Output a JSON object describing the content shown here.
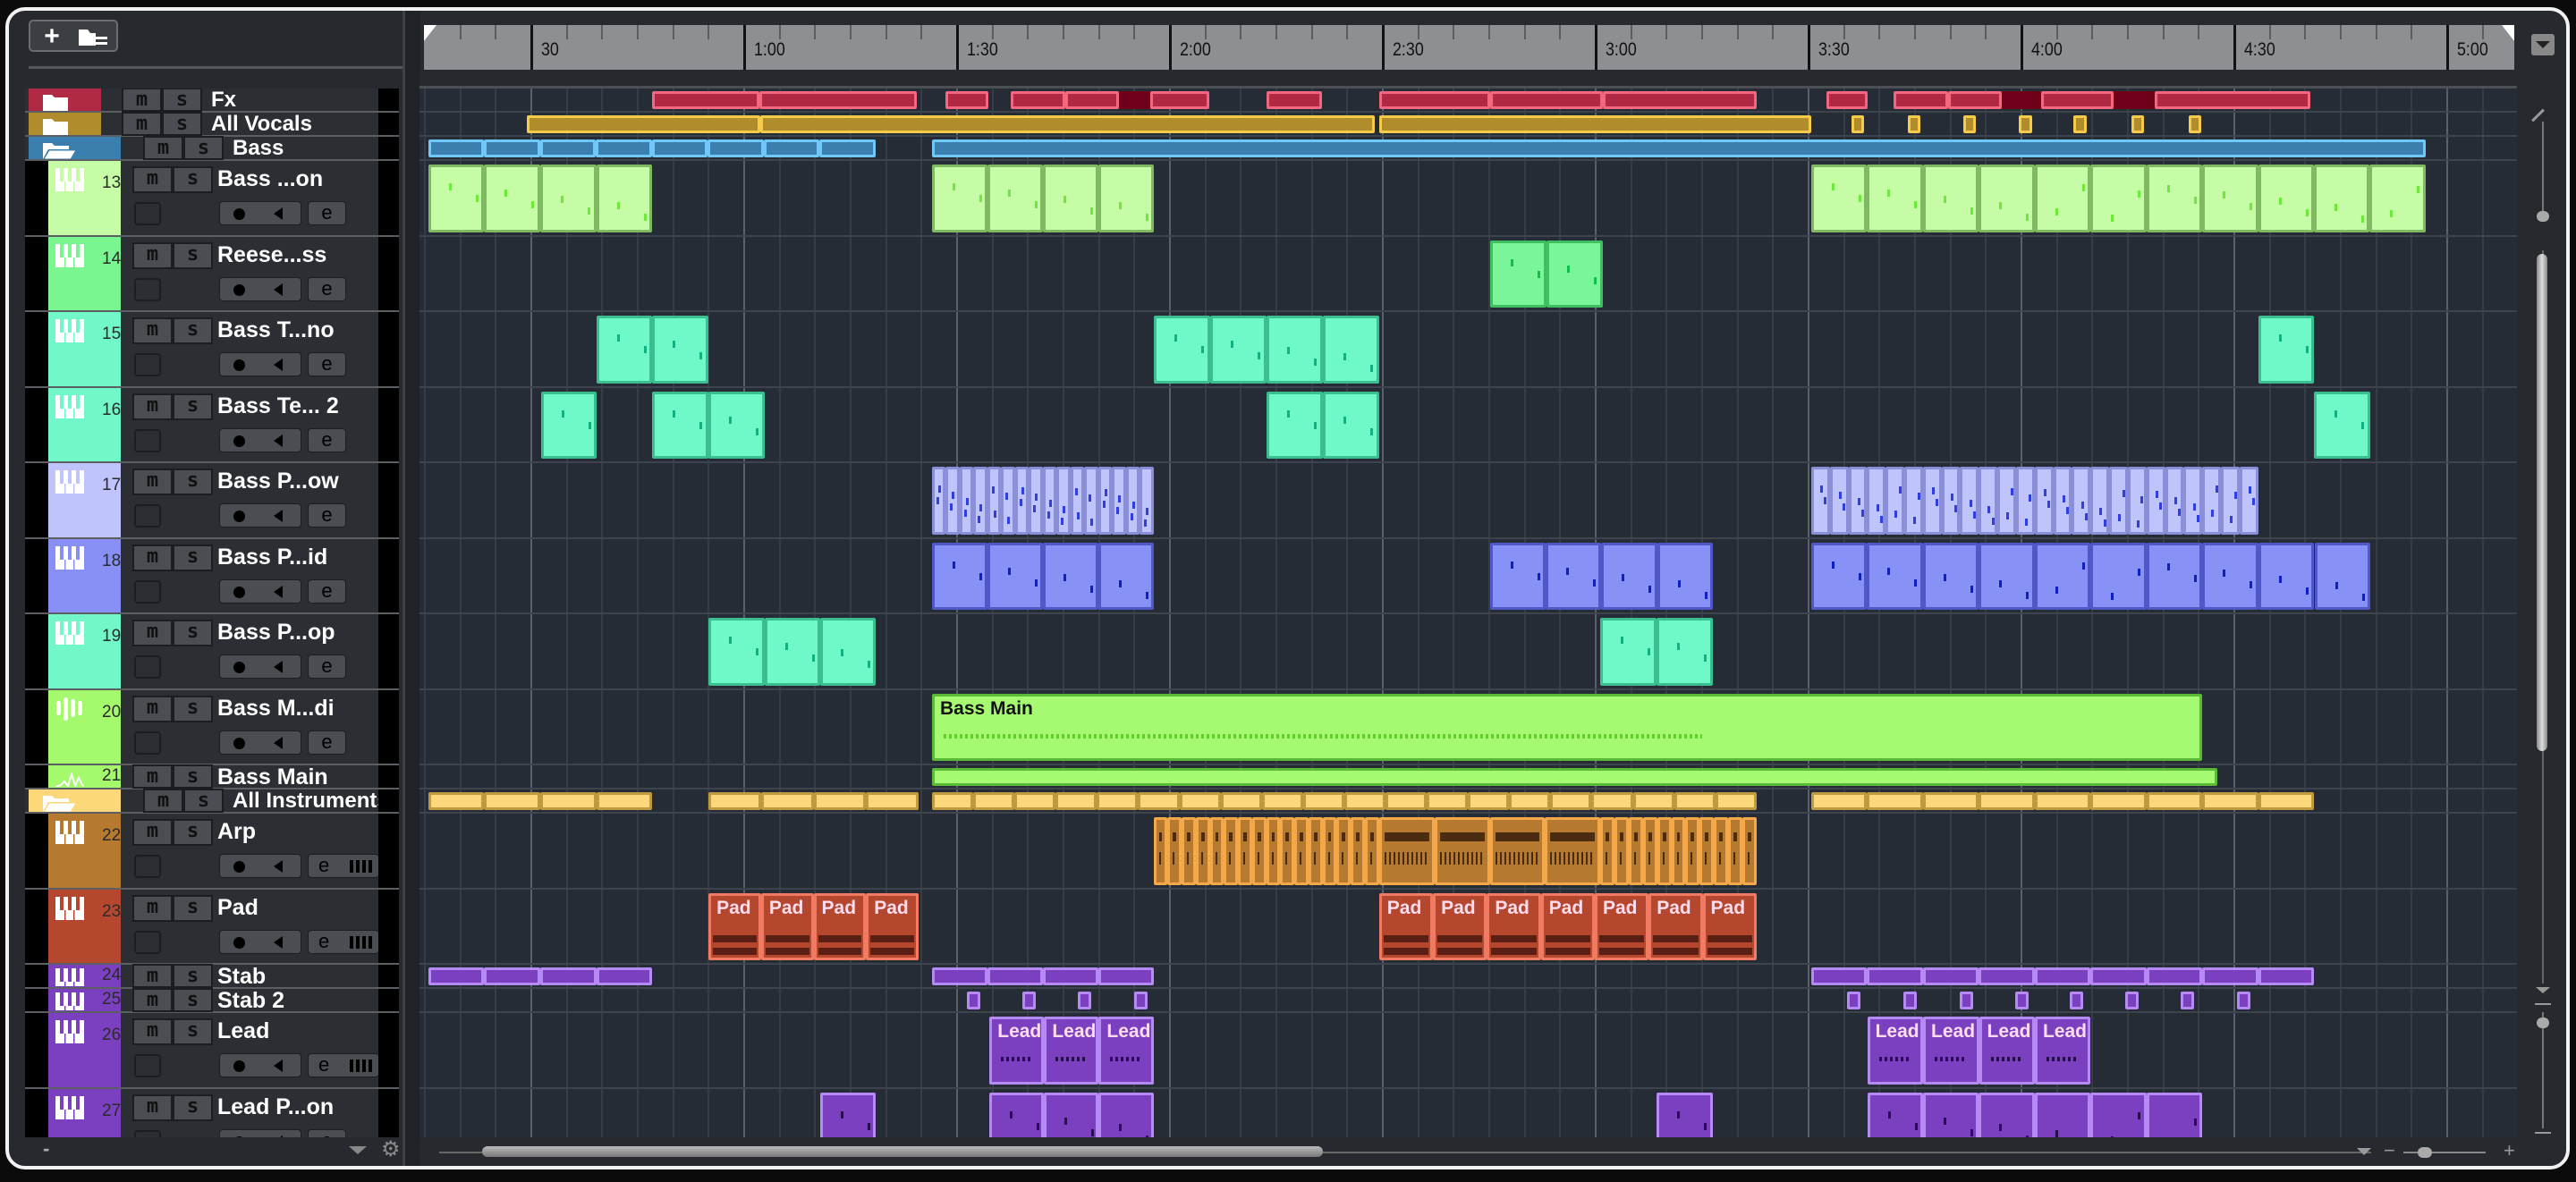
{
  "toolbar": {
    "add": "+",
    "add_icon": "plus-icon",
    "folder_icon": "track-folder-icon"
  },
  "bottom": {
    "minus": "-",
    "plus": "+",
    "zoom_minus": "−"
  },
  "ruler": {
    "range_sec": [
      15.5,
      309.6
    ],
    "labels": [
      {
        "t": 30,
        "text": "30"
      },
      {
        "t": 60,
        "text": "1:00"
      },
      {
        "t": 90,
        "text": "1:30"
      },
      {
        "t": 120,
        "text": "2:00"
      },
      {
        "t": 150,
        "text": "2:30"
      },
      {
        "t": 180,
        "text": "3:00"
      },
      {
        "t": 210,
        "text": "3:30"
      },
      {
        "t": 240,
        "text": "4:00"
      },
      {
        "t": 270,
        "text": "4:30"
      },
      {
        "t": 300,
        "text": "5:00"
      }
    ]
  },
  "track_controls": {
    "mute": "m",
    "solo": "s",
    "edit": "e"
  },
  "tracks": [
    {
      "kind": "folder",
      "name": "Fx",
      "color": "#b02a45",
      "open": false,
      "fill": "#b02a45",
      "border": "#f5677f",
      "clips": [
        {
          "s": 47.2,
          "e": 62.3,
          "n": 1
        },
        {
          "s": 62.3,
          "e": 84.5,
          "n": 1
        },
        {
          "s": 88.5,
          "e": 94.5
        },
        {
          "s": 97.7,
          "e": 113,
          "n": 2
        },
        {
          "s": 113,
          "e": 117.4,
          "dark": true
        },
        {
          "s": 117.4,
          "e": 125.7
        },
        {
          "s": 133.8,
          "e": 141.5
        },
        {
          "s": 149.6,
          "e": 165.3
        },
        {
          "s": 165.3,
          "e": 181.1
        },
        {
          "s": 181.1,
          "e": 202.8
        },
        {
          "s": 212.6,
          "e": 218.4
        },
        {
          "s": 222.1,
          "e": 237.4,
          "n": 2
        },
        {
          "s": 237.4,
          "e": 242.9,
          "dark": true
        },
        {
          "s": 242.9,
          "e": 253.1
        },
        {
          "s": 253.1,
          "e": 258.9,
          "dark": true
        },
        {
          "s": 258.9,
          "e": 280.9
        }
      ]
    },
    {
      "kind": "folder",
      "name": "All Vocals",
      "color": "#b08c2c",
      "open": false,
      "fill": "#b08c2c",
      "border": "#f7cb4a",
      "clips": [
        {
          "s": 29.5,
          "e": 62.4
        },
        {
          "s": 62.4,
          "e": 149
        },
        {
          "s": 149.6,
          "e": 210.5
        },
        {
          "s": 216.2,
          "e": 218
        },
        {
          "s": 224.1,
          "e": 225.9
        },
        {
          "s": 231.9,
          "e": 233.7
        },
        {
          "s": 239.8,
          "e": 241.6
        },
        {
          "s": 247.5,
          "e": 249.3
        },
        {
          "s": 255.6,
          "e": 257.4
        },
        {
          "s": 263.7,
          "e": 265.5
        }
      ]
    },
    {
      "kind": "folder",
      "name": "Bass",
      "color": "#3a7fae",
      "open": true,
      "fill": "#3a7fae",
      "border": "#6fc8f7",
      "clips": [
        {
          "s": 15.6,
          "e": 78.6,
          "n": 8
        },
        {
          "s": 86.6,
          "e": 297.1,
          "n": 1
        }
      ]
    },
    {
      "kind": "track",
      "num": "13",
      "name": "Bass ...on",
      "color": "#c6fca6",
      "icon": "piano-icon",
      "fill": "#c6fca6",
      "border": "#7fb962",
      "note": "#6ee83a",
      "clips": [
        {
          "s": 15.6,
          "e": 47.2,
          "n": 4
        },
        {
          "s": 86.6,
          "e": 117.8,
          "n": 4
        },
        {
          "s": 210.5,
          "e": 297.1,
          "n": 11
        }
      ]
    },
    {
      "kind": "track",
      "num": "14",
      "name": "Reese...ss",
      "color": "#7af58f",
      "icon": "piano-icon",
      "fill": "#7af59a",
      "border": "#3fbf60",
      "note": "#0fbf4c",
      "clips": [
        {
          "s": 165.3,
          "e": 181.1,
          "n": 2
        }
      ]
    },
    {
      "kind": "track",
      "num": "15",
      "name": "Bass T...no",
      "color": "#72f8c8",
      "icon": "piano-icon",
      "fill": "#6ff8c8",
      "border": "#3cbf90",
      "note": "#10b080",
      "clips": [
        {
          "s": 39.3,
          "e": 55.1,
          "n": 2
        },
        {
          "s": 117.8,
          "e": 149.6,
          "n": 4
        },
        {
          "s": 273.5,
          "e": 281.4,
          "n": 1
        }
      ]
    },
    {
      "kind": "track",
      "num": "16",
      "name": "Bass Te... 2",
      "color": "#72f8c8",
      "icon": "piano-icon",
      "fill": "#6ff8c8",
      "border": "#3cbf90",
      "note": "#10b080",
      "clips": [
        {
          "s": 31.5,
          "e": 39.3
        },
        {
          "s": 47.2,
          "e": 63,
          "n": 2
        },
        {
          "s": 133.8,
          "e": 149.6,
          "n": 2
        },
        {
          "s": 281.4,
          "e": 289.3
        }
      ]
    },
    {
      "kind": "track",
      "num": "17",
      "name": "Bass P...ow",
      "color": "#c0c4fc",
      "icon": "piano-icon",
      "fill": "#c0c4fc",
      "border": "#8a8fd8",
      "note": "#3040e0",
      "clips": [
        {
          "s": 86.6,
          "e": 117.8,
          "n": 16
        },
        {
          "s": 210.5,
          "e": 273.5,
          "n": 24
        }
      ]
    },
    {
      "kind": "track",
      "num": "18",
      "name": "Bass P...id",
      "color": "#8890f6",
      "icon": "piano-icon",
      "fill": "#8892f6",
      "border": "#5058c8",
      "note": "#1020c0",
      "clips": [
        {
          "s": 86.6,
          "e": 117.8,
          "n": 4
        },
        {
          "s": 165.3,
          "e": 196.6,
          "n": 4
        },
        {
          "s": 210.5,
          "e": 289.3,
          "n": 10
        }
      ]
    },
    {
      "kind": "track",
      "num": "19",
      "name": "Bass P...op",
      "color": "#72f8c8",
      "icon": "piano-icon",
      "fill": "#6ff8c8",
      "border": "#3cbf90",
      "note": "#10b080",
      "clips": [
        {
          "s": 55.1,
          "e": 78.7,
          "n": 3
        },
        {
          "s": 180.8,
          "e": 196.6,
          "n": 2
        }
      ]
    },
    {
      "kind": "track",
      "num": "20",
      "name": "Bass M...di",
      "color": "#a4fa6c",
      "icon": "sampler-icon",
      "fill": "#a6fa72",
      "border": "#5aba38",
      "note": "#56d81c",
      "clips": [
        {
          "s": 86.6,
          "e": 265.6,
          "n": 1,
          "label": "Bass Main"
        }
      ]
    },
    {
      "kind": "track",
      "num": "21",
      "name": "Bass Main",
      "color": "#a4fa6c",
      "icon": "audio-waveform-icon",
      "collapsed": true,
      "fill": "#a6fa72",
      "border": "#5aba38",
      "clips": [
        {
          "s": 86.6,
          "e": 267.7,
          "n": 1
        }
      ]
    },
    {
      "kind": "folder",
      "name": "All Instruments",
      "color": "#fdd87a",
      "open": true,
      "fill": "#fdd87a",
      "border": "#c09a40",
      "clips": [
        {
          "s": 15.6,
          "e": 47.2,
          "n": 4
        },
        {
          "s": 55.1,
          "e": 84.7,
          "n": 4
        },
        {
          "s": 86.6,
          "e": 202.8,
          "n": 20
        },
        {
          "s": 210.5,
          "e": 281.4,
          "n": 9
        }
      ]
    },
    {
      "kind": "track",
      "num": "22",
      "name": "Arp",
      "color": "#b57a30",
      "icon": "piano-icon",
      "instrument": true,
      "fill": "#b57a30",
      "border": "#f5a84a",
      "style": "arp",
      "clips": [
        {
          "s": 117.8,
          "e": 149.6,
          "n": 16
        },
        {
          "s": 149.6,
          "e": 180.8,
          "n": 4
        },
        {
          "s": 180.8,
          "e": 202.8,
          "n": 11
        }
      ]
    },
    {
      "kind": "track",
      "num": "23",
      "name": "Pad",
      "color": "#b5472e",
      "icon": "piano-icon",
      "instrument": true,
      "fill": "#b5472e",
      "border": "#f07a62",
      "style": "pad",
      "clips": [
        {
          "s": 55.1,
          "e": 84.7,
          "n": 4,
          "label": "Pad"
        },
        {
          "s": 149.6,
          "e": 202.8,
          "n": 7,
          "label": "Pad"
        }
      ]
    },
    {
      "kind": "track",
      "num": "24",
      "name": "Stab",
      "color": "#7a40c0",
      "icon": "piano-icon",
      "collapsed": true,
      "fill": "#7a40c0",
      "border": "#b58af5",
      "clips": [
        {
          "s": 15.6,
          "e": 47.2,
          "n": 4
        },
        {
          "s": 86.6,
          "e": 117.8,
          "n": 4
        },
        {
          "s": 210.5,
          "e": 281.4,
          "n": 9
        }
      ]
    },
    {
      "kind": "track",
      "num": "25",
      "name": "Stab 2",
      "color": "#7a40c0",
      "icon": "piano-icon",
      "collapsed": true,
      "fill": "#7a40c0",
      "border": "#b58af5",
      "clips": [
        {
          "s": 91.5,
          "e": 93.4
        },
        {
          "s": 99.3,
          "e": 101.2
        },
        {
          "s": 107.2,
          "e": 109.1
        },
        {
          "s": 115.1,
          "e": 117
        },
        {
          "s": 215.6,
          "e": 217.5
        },
        {
          "s": 223.5,
          "e": 225.4
        },
        {
          "s": 231.4,
          "e": 233.3
        },
        {
          "s": 239.2,
          "e": 241.1
        },
        {
          "s": 246.9,
          "e": 248.8
        },
        {
          "s": 254.7,
          "e": 256.6
        },
        {
          "s": 262.6,
          "e": 264.5
        },
        {
          "s": 270.5,
          "e": 272.4
        }
      ]
    },
    {
      "kind": "track",
      "num": "26",
      "name": "Lead",
      "color": "#7a40c0",
      "icon": "piano-icon",
      "instrument": true,
      "fill": "#7a40c0",
      "border": "#b58af5",
      "note": "#2a0d50",
      "clips": [
        {
          "s": 94.7,
          "e": 117.8,
          "n": 3,
          "label": "Lead"
        },
        {
          "s": 218.4,
          "e": 249.9,
          "n": 4,
          "label": "Lead"
        }
      ]
    },
    {
      "kind": "track",
      "num": "27",
      "name": "Lead P...on",
      "color": "#7a40c0",
      "icon": "piano-icon",
      "fill": "#7a40c0",
      "border": "#b58af5",
      "note": "#2a0d50",
      "clips": [
        {
          "s": 70.9,
          "e": 78.7
        },
        {
          "s": 94.7,
          "e": 117.8,
          "n": 3
        },
        {
          "s": 188.7,
          "e": 196.6
        },
        {
          "s": 218.4,
          "e": 265.6,
          "n": 6
        }
      ]
    }
  ]
}
